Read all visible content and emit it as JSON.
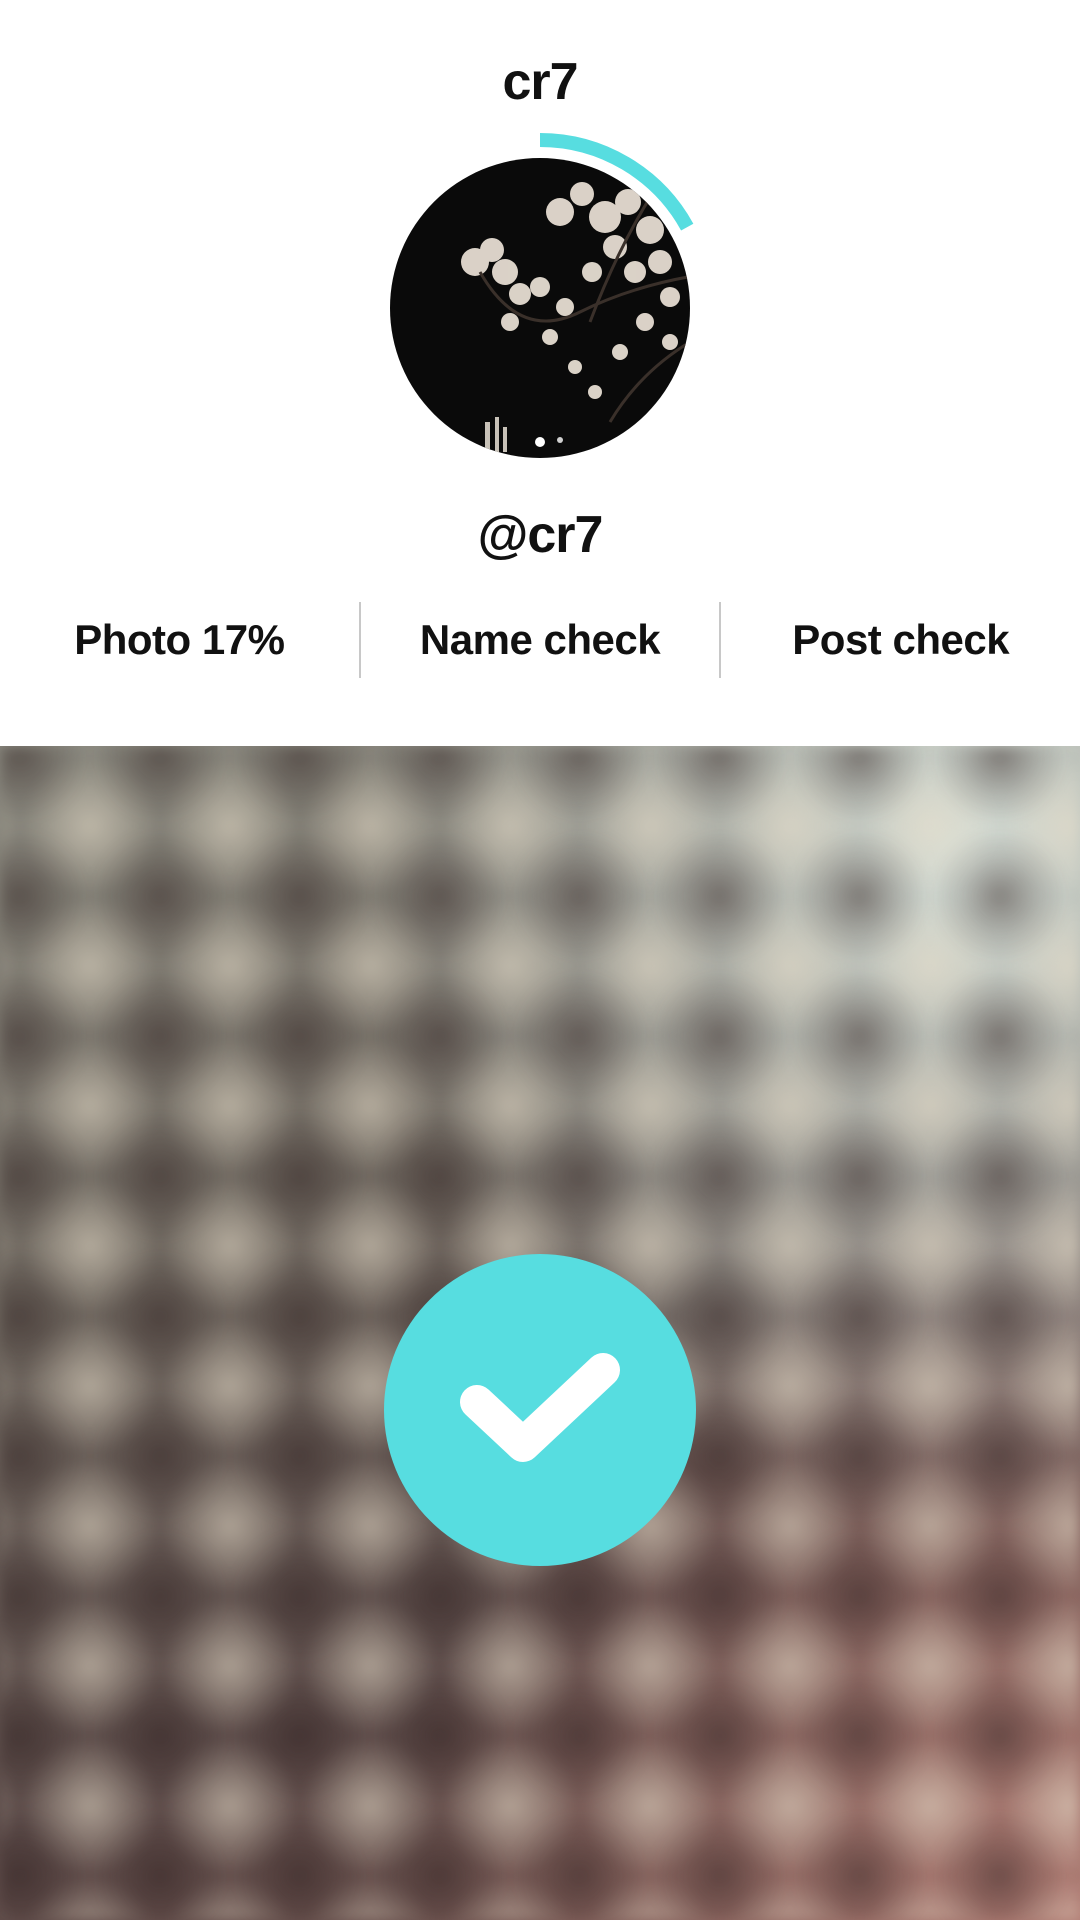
{
  "profile": {
    "title": "cr7",
    "handle": "@cr7",
    "progress_ring": {
      "progress_fraction": 0.17,
      "color": "#57dde0"
    },
    "avatar": {
      "description_icon": "cherry-blossom-photo"
    }
  },
  "stats": [
    {
      "label": "Photo 17%"
    },
    {
      "label": "Name check"
    },
    {
      "label": "Post check"
    }
  ],
  "actions": {
    "confirm_icon": "checkmark-icon",
    "confirm_color": "#57dde0"
  }
}
